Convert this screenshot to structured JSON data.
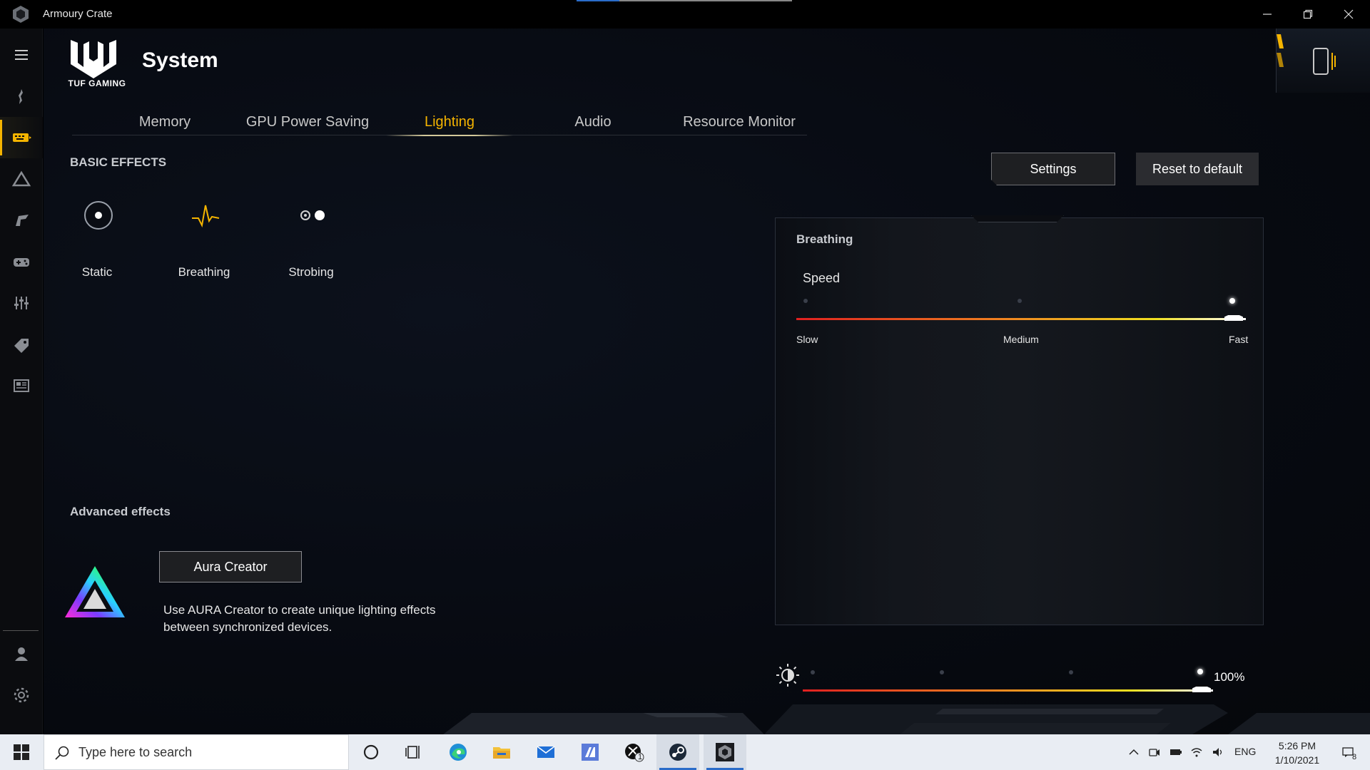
{
  "window": {
    "title": "Armoury Crate"
  },
  "header": {
    "brand": "TUF GAMING",
    "page_title": "System"
  },
  "tabs": [
    {
      "label": "Memory",
      "active": false
    },
    {
      "label": "GPU Power Saving",
      "active": false
    },
    {
      "label": "Lighting",
      "active": true
    },
    {
      "label": "Audio",
      "active": false
    },
    {
      "label": "Resource Monitor",
      "active": false
    }
  ],
  "basic_effects": {
    "heading": "BASIC EFFECTS",
    "items": [
      {
        "label": "Static",
        "icon": "static-icon"
      },
      {
        "label": "Breathing",
        "icon": "breathing-icon"
      },
      {
        "label": "Strobing",
        "icon": "strobing-icon"
      }
    ]
  },
  "actions": {
    "settings": "Settings",
    "reset": "Reset to default"
  },
  "effect_panel": {
    "title": "Breathing",
    "speed_label": "Speed",
    "ticks": [
      "Slow",
      "Medium",
      "Fast"
    ],
    "selected": "Fast"
  },
  "advanced": {
    "heading": "Advanced effects",
    "button": "Aura Creator",
    "description": "Use AURA Creator to create unique lighting effects between synchronized devices."
  },
  "brightness": {
    "value": "100%",
    "level": 1.0
  },
  "taskbar": {
    "search_placeholder": "Type here to search",
    "language": "ENG",
    "time": "5:26 PM",
    "date": "1/10/2021",
    "xbox_badge": "1",
    "notification_count": "8"
  },
  "colors": {
    "accent": "#f5b400",
    "background": "#070a11",
    "slider_start": "#e02020",
    "slider_mid": "#f0a020",
    "slider_end": "#ffffff"
  }
}
